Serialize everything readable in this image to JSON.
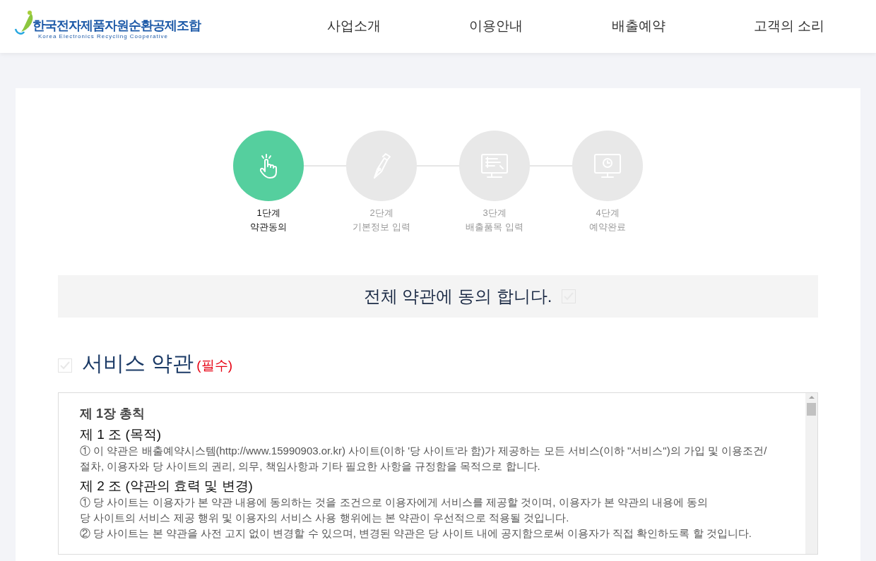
{
  "header": {
    "logo_title": "한국전자제품자원순환공제조합",
    "logo_subtitle": "Korea Electronics Recycling Cooperative",
    "nav": [
      "사업소개",
      "이용안내",
      "배출예약",
      "고객의 소리"
    ]
  },
  "steps": [
    {
      "kind": "tap",
      "label": "1단계",
      "caption": "약관동의",
      "selected": true
    },
    {
      "kind": "pen",
      "label": "2단계",
      "caption": "기본정보 입력",
      "selected": false
    },
    {
      "kind": "form",
      "label": "3단계",
      "caption": "배출품목 입력",
      "selected": false
    },
    {
      "kind": "clock",
      "label": "4단계",
      "caption": "예약완료",
      "selected": false
    }
  ],
  "agree_all": {
    "label": "전체 약관에 동의 합니다.",
    "checked": false
  },
  "service_terms": {
    "title": "서비스 약관",
    "required": "(필수)",
    "checked": false,
    "content": [
      {
        "kind": "chapter",
        "text": "제 1장 총칙"
      },
      {
        "kind": "article",
        "text": "제 1 조 (목적)"
      },
      {
        "kind": "paragraph",
        "text": "① 이 약관은 배출예약시스템(http://www.15990903.or.kr) 사이트(이하 '당 사이트'라 함)가 제공하는 모든 서비스(이하 \"서비스\")의 가입 및 이용조건/절차, 이용자와 당 사이트의 권리, 의무, 책임사항과 기타 필요한 사항을 규정함을 목적으로 합니다."
      },
      {
        "kind": "article",
        "text": "제 2 조 (약관의 효력 및 변경)"
      },
      {
        "kind": "paragraph",
        "text": "① 당 사이트는 이용자가 본 약관 내용에 동의하는 것을 조건으로 이용자에게 서비스를 제공할 것이며, 이용자가 본 약관의 내용에 동의"
      },
      {
        "kind": "paragraph",
        "text": "당 사이트의 서비스 제공 행위 및 이용자의 서비스 사용 행위에는 본 약관이 우선적으로 적용될 것입니다."
      },
      {
        "kind": "paragraph",
        "text": "② 당 사이트는 본 약관을 사전 고지 없이 변경할 수 있으며, 변경된 약관은 당 사이트 내에 공지함으로써 이용자가 직접 확인하도록 할 것입니다."
      }
    ]
  }
}
